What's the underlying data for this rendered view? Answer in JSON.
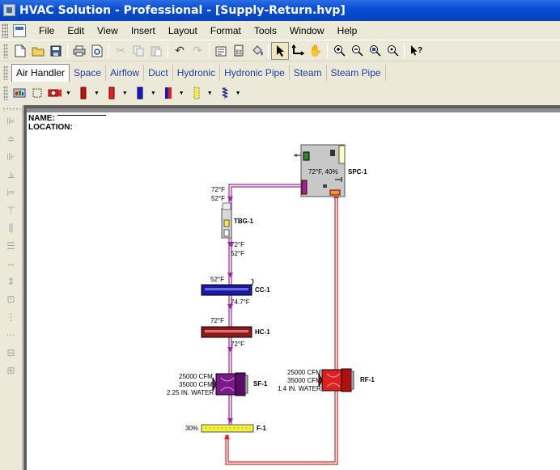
{
  "window": {
    "title": "HVAC Solution - Professional - [Supply-Return.hvp]"
  },
  "menu": [
    "File",
    "Edit",
    "View",
    "Insert",
    "Layout",
    "Format",
    "Tools",
    "Window",
    "Help"
  ],
  "toolbar": {
    "icons": [
      "new-icon",
      "open-icon",
      "save-icon",
      "print-icon",
      "print-preview-icon",
      "cut-icon",
      "copy-icon",
      "paste-icon",
      "undo-icon",
      "redo-icon",
      "properties-icon",
      "calculator-icon",
      "paint-bucket-icon",
      "select-arrow-icon",
      "connect-icon",
      "pan-hand-icon",
      "zoom-in-icon",
      "zoom-out-icon",
      "zoom-fit-icon",
      "zoom-window-icon",
      "help-pointer-icon"
    ]
  },
  "tabs": [
    {
      "label": "Air Handler",
      "active": true
    },
    {
      "label": "Space"
    },
    {
      "label": "Airflow"
    },
    {
      "label": "Duct"
    },
    {
      "label": "Hydronic"
    },
    {
      "label": "Hydronic Pipe"
    },
    {
      "label": "Steam"
    },
    {
      "label": "Steam Pipe"
    }
  ],
  "header": {
    "name_label": "NAME:",
    "location_label": "LOCATION:"
  },
  "diagram": {
    "spc": {
      "label": "SPC-1",
      "reading": "72°F, 40%"
    },
    "tbg": {
      "label": "TBG-1",
      "in_temp": "72°F",
      "in_temp2": "52°F",
      "out_temp": "72°F",
      "out_temp2": "52°F"
    },
    "cc": {
      "label": "CC-1",
      "in_temp": "52°F",
      "out_temp": "74.7°F"
    },
    "hc": {
      "label": "HC-1",
      "in_temp": "72°F",
      "out_temp": "72°F"
    },
    "sf": {
      "label": "SF-1",
      "line1": "25000 CFM",
      "line2": "35000 CFM",
      "line3": "2.25 IN. WATER"
    },
    "rf": {
      "label": "RF-1",
      "line1": "25000 CFM",
      "line2": "35000 CFM",
      "line3": "1.4 IN. WATER"
    },
    "filter": {
      "label": "F-1",
      "value": "30%"
    }
  },
  "colors": {
    "supply": "#a020a0",
    "return": "#e02020",
    "coil_cool": "#1a1aa0",
    "coil_heat": "#8b1a1a",
    "fan_supply": "#7a1a8a",
    "fan_return": "#e02020",
    "filter": "#f0f040"
  }
}
